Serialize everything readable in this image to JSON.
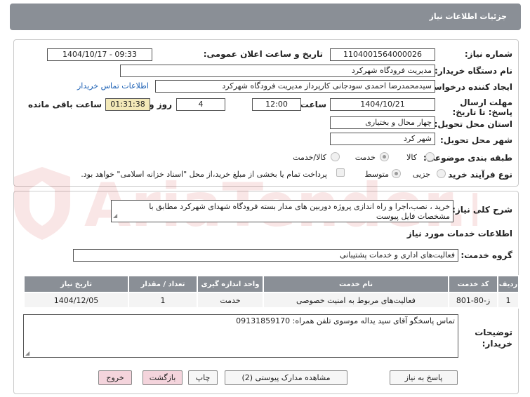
{
  "header": {
    "title": "جزئیات اطلاعات نیاز"
  },
  "form": {
    "need_number_label": "شماره نیاز:",
    "need_number": "1104001564000026",
    "announce_label": "تاریخ و ساعت اعلان عمومی:",
    "announce_value": "1404/10/17 - 09:33",
    "buyer_org_label": "نام دستگاه خریدار:",
    "buyer_org": "مدیریت فرودگاه شهرکرد",
    "requester_label": "ایجاد کننده درخواست:",
    "requester": "سیدمحمدرضا احمدی سودجانی کارپرداز مدیریت فرودگاه شهرکرد",
    "contact_link": "اطلاعات تماس خریدار",
    "deadline_label": "مهلت ارسال پاسخ: تا تاریخ:",
    "deadline_date": "1404/10/21",
    "time_label": "ساعت",
    "deadline_time": "12:00",
    "days_value": "4",
    "days_label": "روز و",
    "remaining_time": "01:31:38",
    "remaining_label": "ساعت باقی مانده",
    "province_label": "استان محل تحویل:",
    "province": "چهار محال و بختیاری",
    "city_label": "شهر محل تحویل:",
    "city": "شهر کرد",
    "category_label": "طبقه بندی موضوعی:",
    "category_options": [
      "کالا",
      "خدمت",
      "کالا/خدمت"
    ],
    "category_selected": "خدمت",
    "process_label": "نوع فرآیند خرید :",
    "process_options": [
      "جزیی",
      "متوسط"
    ],
    "process_selected": "متوسط",
    "payment_note": "پرداخت تمام یا بخشی از مبلغ خرید،از محل \"اسناد خزانه اسلامی\" خواهد بود."
  },
  "summary": {
    "label": "شرح کلی نیاز:",
    "text": "خرید ، نصب،اجرا و راه اندازی پروژه دوربین های مدار بسته  فرودگاه  شهدای شهرکرد مطابق با مشخصات  فایل پیوست"
  },
  "services": {
    "section_title": "اطلاعات خدمات مورد نیاز",
    "group_label": "گروه خدمت:",
    "group_value": "فعالیت‌های اداری و خدمات پشتیبانی",
    "columns": [
      "ردیف",
      "کد خدمت",
      "نام خدمت",
      "واحد اندازه گیری",
      "تعداد / مقدار",
      "تاریخ نیاز"
    ],
    "rows": [
      [
        "1",
        "ز-80-801",
        "فعالیت‌های مربوط به امنیت خصوصی",
        "خدمت",
        "1",
        "1404/12/05"
      ]
    ]
  },
  "notes": {
    "label": "توضیحات خریدار:",
    "text": "تماس پاسخگو آقای سید یداله موسوی  تلفن همراه: 09131859170"
  },
  "buttons": {
    "reply": "پاسخ به نیاز",
    "attachments": "مشاهده مدارک پیوستی (2)",
    "print": "چاپ",
    "back": "بازگشت",
    "exit": "خروج"
  },
  "watermark": {
    "text": "AriaTender.net"
  },
  "colors": {
    "header_bg": "#8a8f96",
    "link": "#1a5fb4",
    "remaining_bg": "#f3e9b8",
    "watermark": "#d23c3c"
  }
}
